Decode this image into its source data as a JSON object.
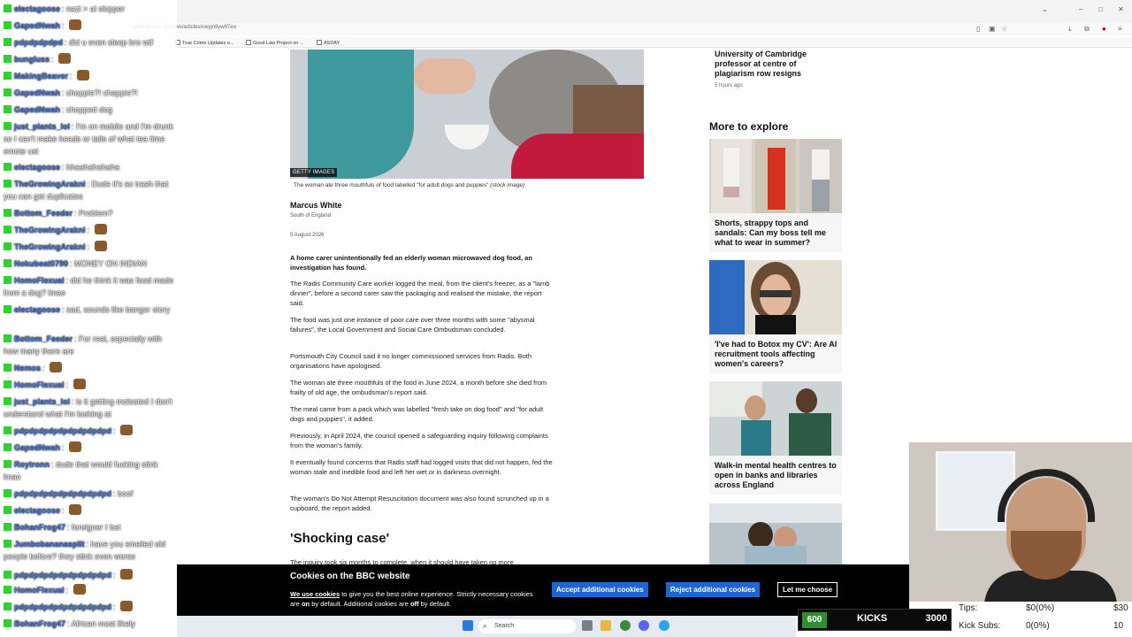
{
  "browser": {
    "url": "www.bbc.co.uk/news/articles/cwyjn9yw97eo",
    "bookmarks": [
      "True Crime Updates o...",
      "Good Law Project on ...",
      "ASDAY"
    ]
  },
  "article": {
    "image_credit": "GETTY IMAGES",
    "caption": "The woman ate three mouthfuls of food labelled \"for adult dogs and puppies\"",
    "caption_suffix": "(stock image)",
    "author": "Marcus White",
    "region": "South of England",
    "date": "5 August 2026",
    "paragraphs": [
      "A home carer unintentionally fed an elderly woman microwaved dog food, an investigation has found.",
      "The Radis Community Care worker logged the meal, from the client's freezer, as a \"lamb dinner\", before a second carer saw the packaging and realised the mistake, the report said.",
      "The food was just one instance of poor care over three months with some \"abysmal failures\", the Local Government and Social Care Ombudsman concluded.",
      "Portsmouth City Council said it no longer commissioned services from Radis. Both organisations have apologised.",
      "The woman ate three mouthfuls of the food in June 2024, a month before she died from frailty of old age, the ombudsman's report said.",
      "The meal came from a pack which was labelled \"fresh take on dog food\" and \"for adult dogs and puppies\", it added.",
      "Previously, in April 2024, the council opened a safeguarding inquiry following complaints from the woman's family.",
      "It eventually found concerns that Radis staff had logged visits that did not happen, fed the woman stale and inedible food and left her wet or in darkness overnight.",
      "The woman's Do Not Attempt Resuscitation document was also found scrunched up in a cupboard, the report added."
    ],
    "subheading": "'Shocking case'",
    "cut_paragraph": "The inquiry took six months to complete, when it should have taken no more"
  },
  "sidebar": {
    "top_story": {
      "title": "University of Cambridge professor at centre of plagiarism row resigns",
      "time": "5 hours ago"
    },
    "more_heading": "More to explore",
    "cards": [
      {
        "title": "Shorts, strappy tops and sandals: Can my boss tell me what to wear in summer?"
      },
      {
        "title": "'I've had to Botox my CV': Are AI recruitment tools affecting women's careers?"
      },
      {
        "title": "Walk-in mental health centres to open in banks and libraries across England"
      }
    ]
  },
  "cookie": {
    "title": "Cookies on the BBC website",
    "link": "We use cookies",
    "body_a": " to give you the best online experience. Strictly necessary cookies are ",
    "on": "on",
    "body_b": " by default. Additional cookies are ",
    "off": "off",
    "body_c": " by default.",
    "accept": "Accept additional cookies",
    "reject": "Reject additional cookies",
    "choose": "Let me choose"
  },
  "taskbar": {
    "search": "Search"
  },
  "chat": [
    {
      "user": "electagoose",
      "text": "nazi > ai slopper"
    },
    {
      "user": "GapedNwah",
      "text": ""
    },
    {
      "user": "pdpdpdpdpd",
      "text": "did u even sleep bro wtf"
    },
    {
      "user": "bungluss",
      "text": ""
    },
    {
      "user": "MakingBeaver",
      "text": ""
    },
    {
      "user": "GapedNwah",
      "text": "choppie?! chappie?!"
    },
    {
      "user": "GapedNwah",
      "text": "chopped dog"
    },
    {
      "user": "just_plants_lol",
      "text": "I'm on mobile and I'm drunk so I can't make heads or tails of what tea time emote ust"
    },
    {
      "user": "electagoose",
      "text": "hhaahahahaha"
    },
    {
      "user": "TheGrowingArakni",
      "text": "Dude it's so trash that you can get duplicates"
    },
    {
      "user": "Bottom_Feeder",
      "text": "Problem?"
    },
    {
      "user": "TheGrowingArakni",
      "text": ""
    },
    {
      "user": "TheGrowingArakni",
      "text": ""
    },
    {
      "user": "Nokubeat0790",
      "text": "MONEY ON INDIAN"
    },
    {
      "user": "HomoFlexual",
      "text": "did he think it was food made from a dog? lmao"
    },
    {
      "user": "electagoose",
      "text": "sad, sounds like banger story"
    },
    {
      "user": "Bottom_Feeder",
      "text": "For real, especially with how many there are"
    },
    {
      "user": "Nemos",
      "text": ""
    },
    {
      "user": "HomoFlexual",
      "text": ""
    },
    {
      "user": "just_plants_lol",
      "text": "is it getting molested I don't understand what I'm looking at"
    },
    {
      "user": "pdpdpdpdpdpdpdpdpdpd",
      "text": ""
    },
    {
      "user": "GapedNwah",
      "text": ""
    },
    {
      "user": "Roytronn",
      "text": "dude that would fucking stink lmao"
    },
    {
      "user": "pdpdpdpdpdpdpdpdpdpd",
      "text": "boof"
    },
    {
      "user": "electagoose",
      "text": ""
    },
    {
      "user": "BohanFrog47",
      "text": "foreigner I bet"
    },
    {
      "user": "Jumbobananasplit",
      "text": "have you smelled old people before? they stink even worse"
    },
    {
      "user": "pdpdpdpdpdpdpdpdpdpd",
      "text": ""
    },
    {
      "user": "HomoFlexual",
      "text": ""
    },
    {
      "user": "pdpdpdpdpdpdpdpdpdpd",
      "text": ""
    },
    {
      "user": "BohanFrog47",
      "text": "African most likely"
    }
  ],
  "kicks": {
    "low": "600",
    "label": "KICKS",
    "high": "3000"
  },
  "stats": {
    "tips_label": "Tips:",
    "tips_value": "$0(0%)",
    "tips_goal": "$30",
    "subs_label": "Kick Subs:",
    "subs_value": "0(0%)",
    "subs_goal": "10"
  }
}
